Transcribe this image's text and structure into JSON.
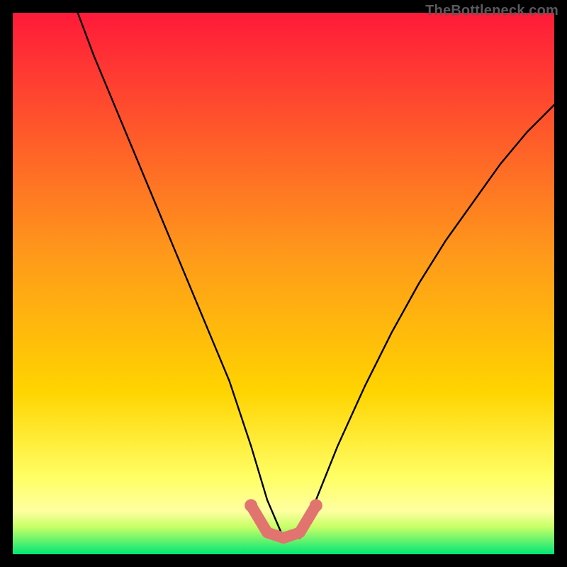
{
  "watermark": "TheBottleneck.com",
  "chart_data": {
    "type": "line",
    "title": "",
    "xlabel": "",
    "ylabel": "",
    "xlim": [
      0,
      100
    ],
    "ylim": [
      0,
      100
    ],
    "grid": false,
    "series": [
      {
        "name": "bottleneck-curve",
        "x": [
          12,
          15,
          20,
          25,
          30,
          35,
          40,
          44,
          47,
          50,
          53,
          56,
          60,
          65,
          70,
          75,
          80,
          85,
          90,
          95,
          100
        ],
        "y": [
          100,
          92,
          80,
          68,
          56,
          44,
          32,
          20,
          10,
          3,
          3,
          10,
          20,
          31,
          41,
          50,
          58,
          65,
          72,
          78,
          83
        ]
      }
    ],
    "highlight": {
      "name": "minimum-region",
      "x": [
        44,
        47,
        50,
        53,
        56
      ],
      "y": [
        9,
        4,
        3,
        4,
        9
      ]
    },
    "background": {
      "top_color": "#ff1a3a",
      "mid_color": "#ffd400",
      "near_bottom_color": "#ffff66",
      "bottom_color": "#00e676"
    }
  }
}
